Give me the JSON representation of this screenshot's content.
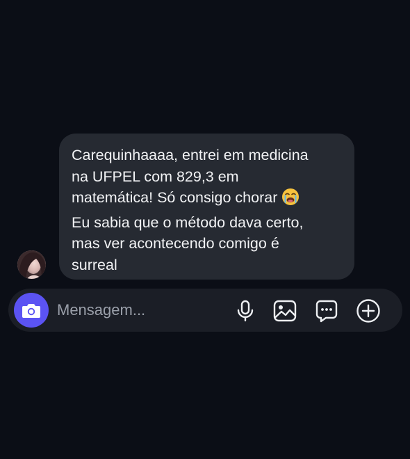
{
  "message": {
    "lines": [
      "Carequinhaaaa, entrei em medicina",
      "na UFPEL com 829,3 em",
      "matemática! Só consigo chorar",
      "Eu sabia que o método dava certo,",
      "mas ver acontecendo comigo é",
      "surreal"
    ],
    "emoji": "loudly-crying-face"
  },
  "composer": {
    "placeholder": "Mensagem..."
  },
  "icons": {
    "camera": "camera-icon",
    "microphone": "microphone-icon",
    "gallery": "image-icon",
    "sticker": "chat-bubble-icon",
    "add": "plus-circle-icon"
  },
  "colors": {
    "background": "#0b0e16",
    "bubble": "#262a32",
    "composer": "#1b1e26",
    "camera_button": "#5b53f3",
    "text": "#f1f2f4",
    "placeholder": "#9a9fa9"
  }
}
